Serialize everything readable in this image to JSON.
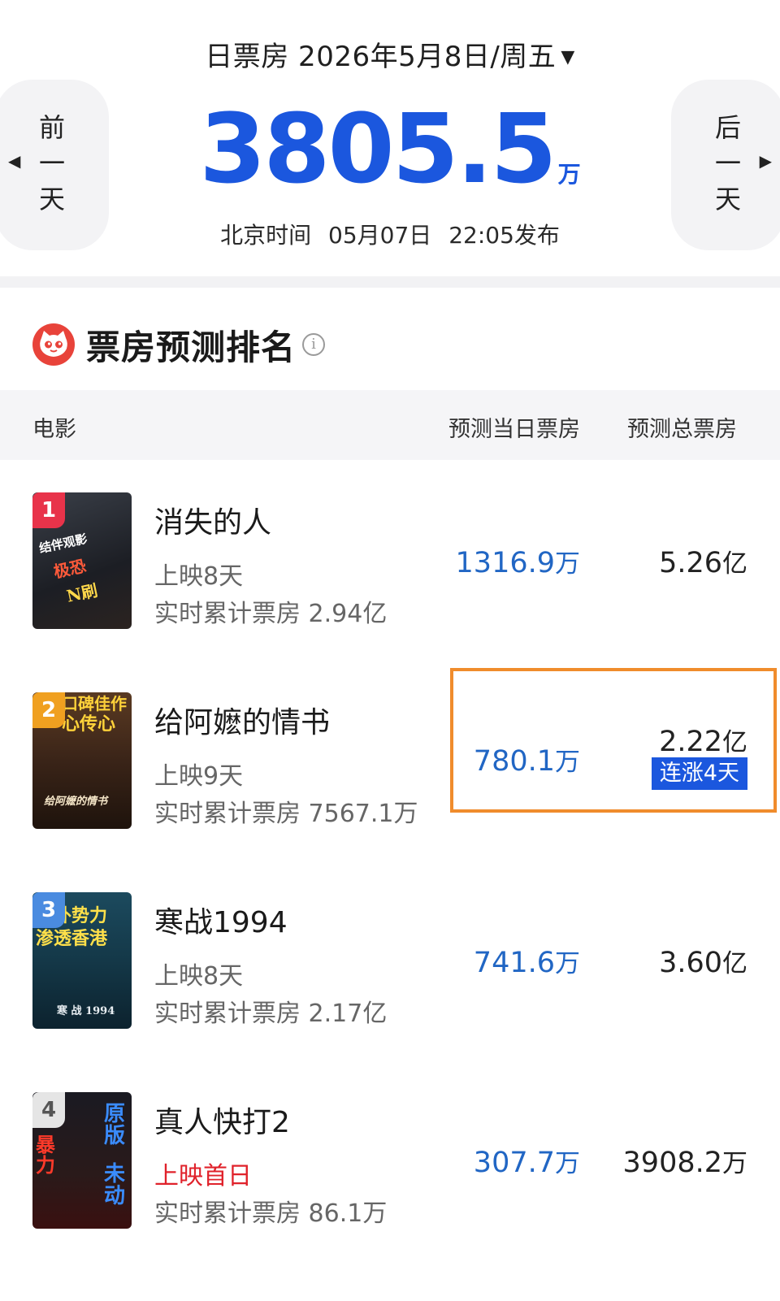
{
  "header": {
    "date_label": "日票房 2026年5月8日/周五",
    "prev_day_chars": [
      "前",
      "一",
      "天"
    ],
    "next_day_chars": [
      "后",
      "一",
      "天"
    ],
    "total_value": "3805.5",
    "total_unit": "万",
    "publish_prefix": "北京时间",
    "publish_date": "05月07日",
    "publish_time": "22:05发布"
  },
  "section": {
    "title": "票房预测排名",
    "info_glyph": "i"
  },
  "table": {
    "headers": {
      "movie": "电影",
      "daily": "预测当日票房",
      "total": "预测总票房"
    }
  },
  "rows": [
    {
      "rank": "1",
      "rank_color": "#e8334a",
      "name": "消失的人",
      "days": "上映8天",
      "cumulative": "实时累计票房 2.94亿",
      "daily_value": "1316.9",
      "daily_unit": "万",
      "total_value": "5.26",
      "total_unit": "亿",
      "poster_lines": [
        "结伴观影",
        "极恐",
        "N刷"
      ]
    },
    {
      "rank": "2",
      "rank_color": "#f0a020",
      "name": "给阿嬷的情书",
      "days": "上映9天",
      "cumulative": "实时累计票房 7567.1万",
      "daily_value": "780.1",
      "daily_unit": "万",
      "total_value": "2.22",
      "total_unit": "亿",
      "badge": "连涨4天",
      "poster_lines": [
        "口碑佳作",
        "心传心",
        "给阿嬷的情书"
      ]
    },
    {
      "rank": "3",
      "rank_color": "#4a8be0",
      "name": "寒战1994",
      "days": "上映8天",
      "cumulative": "实时累计票房 2.17亿",
      "daily_value": "741.6",
      "daily_unit": "万",
      "total_value": "3.60",
      "total_unit": "亿",
      "poster_lines": [
        "境外势力",
        "渗透香港",
        "寒 战 1994"
      ]
    },
    {
      "rank": "4",
      "rank_color": "#9a9a9a",
      "name": "真人快打2",
      "days": "上映首日",
      "cumulative": "实时累计票房 86.1万",
      "daily_value": "307.7",
      "daily_unit": "万",
      "total_value": "3908.2",
      "total_unit": "万",
      "poster_lines": [
        "原版",
        "未动",
        "暴力"
      ]
    }
  ],
  "colors": {
    "accent_blue": "#1b57de",
    "value_blue": "#2166c4",
    "highlight_orange": "#f08c2c",
    "first_day_red": "#e0222b",
    "logo_red": "#e8433a"
  }
}
